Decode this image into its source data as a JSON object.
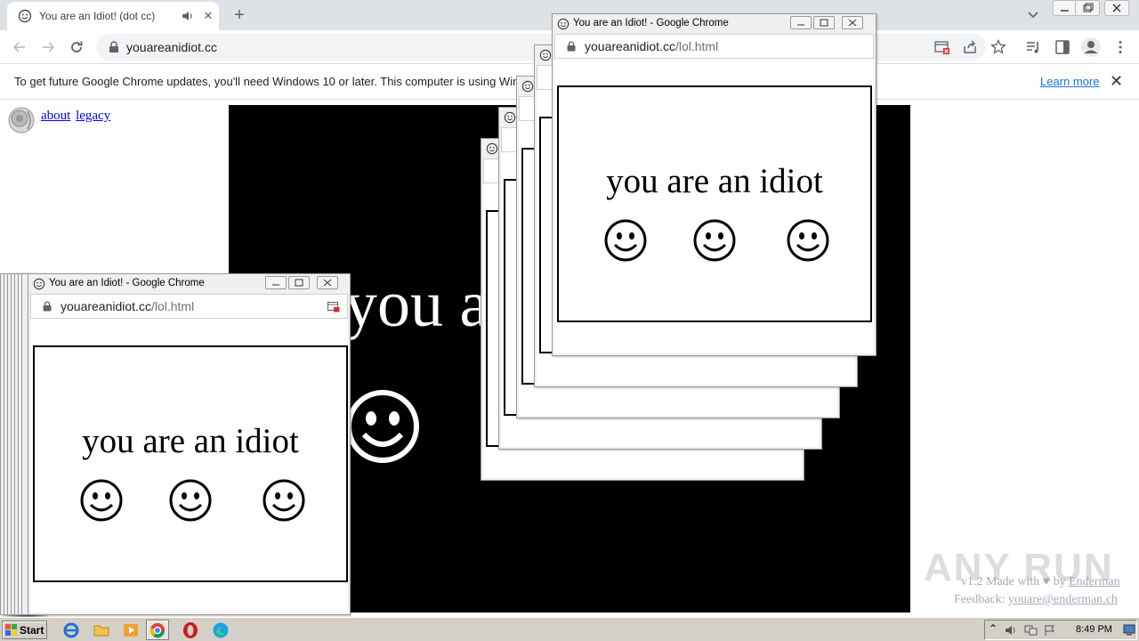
{
  "tab": {
    "title": "You are an Idiot! (dot cc)"
  },
  "omnibox": {
    "url": "youareanidiot.cc"
  },
  "infobar": {
    "message": "To get future Google Chrome updates, you'll need Windows 10 or later. This computer is using Windows 7.",
    "learn_more": "Learn more"
  },
  "page": {
    "links": [
      "about",
      "legacy"
    ],
    "big_text": "you are an idiot",
    "footer_made": "v1.2 Made with",
    "footer_by": "by",
    "footer_author": "Enderman",
    "footer_feedback_label": "Feedback:",
    "footer_feedback_email": "youare@enderman.ch",
    "watermark": "ANY RUN"
  },
  "popup": {
    "title": "You are an Idiot! - Google Chrome",
    "domain": "youareanidiot.cc",
    "path": "/lol.html",
    "text": "you are an idiot"
  },
  "taskbar": {
    "start": "Start",
    "clock": "8:49 PM"
  },
  "icons": {
    "favicon": "smiley-icon",
    "audio": "speaker-icon",
    "lock": "lock-icon",
    "popup_blocked": "popup-blocked-icon"
  }
}
